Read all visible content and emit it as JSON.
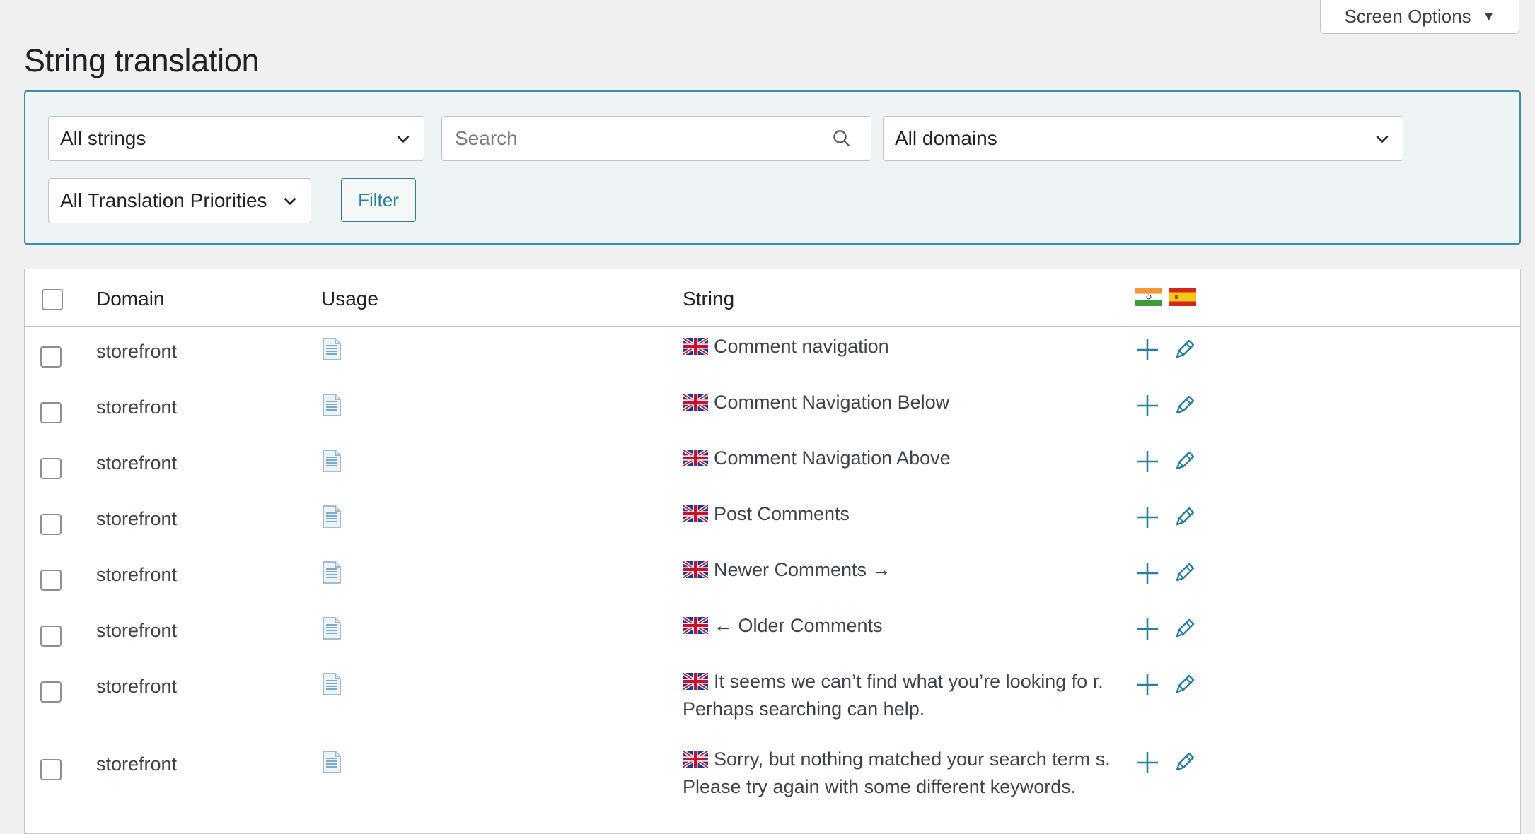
{
  "header": {
    "title": "String translation",
    "screen_options": "Screen Options"
  },
  "filters": {
    "strings_select": "All strings",
    "search_placeholder": "Search",
    "domains_select": "All domains",
    "priorities_select": "All Translation Priorities",
    "filter_button": "Filter"
  },
  "table": {
    "columns": {
      "domain": "Domain",
      "usage": "Usage",
      "string": "String"
    },
    "language_flags": [
      "india-flag",
      "spain-flag"
    ],
    "rows": [
      {
        "domain": "storefront",
        "string": "Comment navigation"
      },
      {
        "domain": "storefront",
        "string": "Comment Navigation Below"
      },
      {
        "domain": "storefront",
        "string": "Comment Navigation Above"
      },
      {
        "domain": "storefront",
        "string": "Post Comments"
      },
      {
        "domain": "storefront",
        "string": "Newer Comments →"
      },
      {
        "domain": "storefront",
        "string": "← Older Comments"
      },
      {
        "domain": "storefront",
        "string": "It seems we can’t find what you’re looking fo r. Perhaps searching can help."
      },
      {
        "domain": "storefront",
        "string": "Sorry, but nothing matched your search term s. Please try again with some different keywords."
      }
    ]
  },
  "colors": {
    "accent": "#2a7e9a",
    "filter_bg": "#eef4f5",
    "page_bg": "#f0f0f1"
  }
}
